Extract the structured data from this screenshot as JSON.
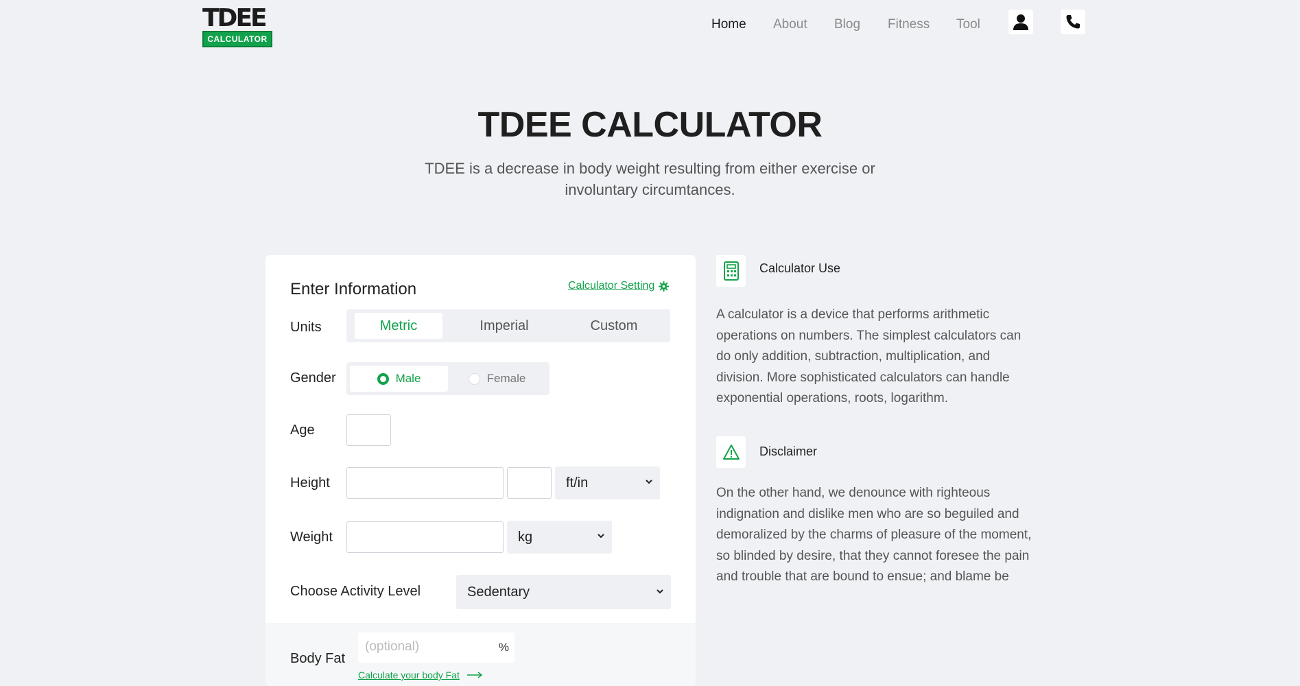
{
  "logo": {
    "top_text": "TDEE",
    "bottom_text": "CALCULATOR"
  },
  "nav": {
    "items": [
      "Home",
      "About",
      "Blog",
      "Fitness",
      "Tool"
    ],
    "active": "Home",
    "user_icon": "user-icon",
    "phone_icon": "phone-icon"
  },
  "hero": {
    "title": "TDEE CALCULATOR",
    "subtitle": "TDEE is a decrease in body weight resulting from either exercise or involuntary circumtances."
  },
  "form": {
    "title": "Enter Information",
    "setting_link": "Calculator Setting",
    "units_label": "Units",
    "units_tabs": [
      "Metric",
      "Imperial",
      "Custom"
    ],
    "units_selected": "Metric",
    "gender_label": "Gender",
    "gender_options": [
      "Male",
      "Female"
    ],
    "gender_selected": "Male",
    "age_label": "Age",
    "age_value": "",
    "height_label": "Height",
    "height_value_1": "",
    "height_value_2": "",
    "height_unit": "ft/in",
    "weight_label": "Weight",
    "weight_value": "",
    "weight_unit": "kg",
    "activity_label": "Choose Activity Level",
    "activity_value": "Sedentary",
    "bodyfat_label": "Body Fat",
    "bodyfat_placeholder": "(optional)",
    "bodyfat_unit": "%",
    "bodyfat_link": "Calculate your body Fat"
  },
  "info": {
    "calc_use_title": "Calculator Use",
    "calc_use_text": "A calculator is a device that performs arithmetic operations on numbers. The simplest calculators can do only addition, subtraction, multiplication, and division. More sophisticated calculators can handle exponential operations, roots, logarithm.",
    "disclaimer_title": "Disclaimer",
    "disclaimer_text": "On the other hand, we denounce with righteous indignation and dislike men who are so beguiled and demoralized by the charms of pleasure of the moment, so blinded by desire, that they cannot foresee the pain and trouble that are bound to ensue; and blame be"
  },
  "colors": {
    "accent": "#12a24b",
    "background": "#eff1f5",
    "card": "#ffffff"
  }
}
